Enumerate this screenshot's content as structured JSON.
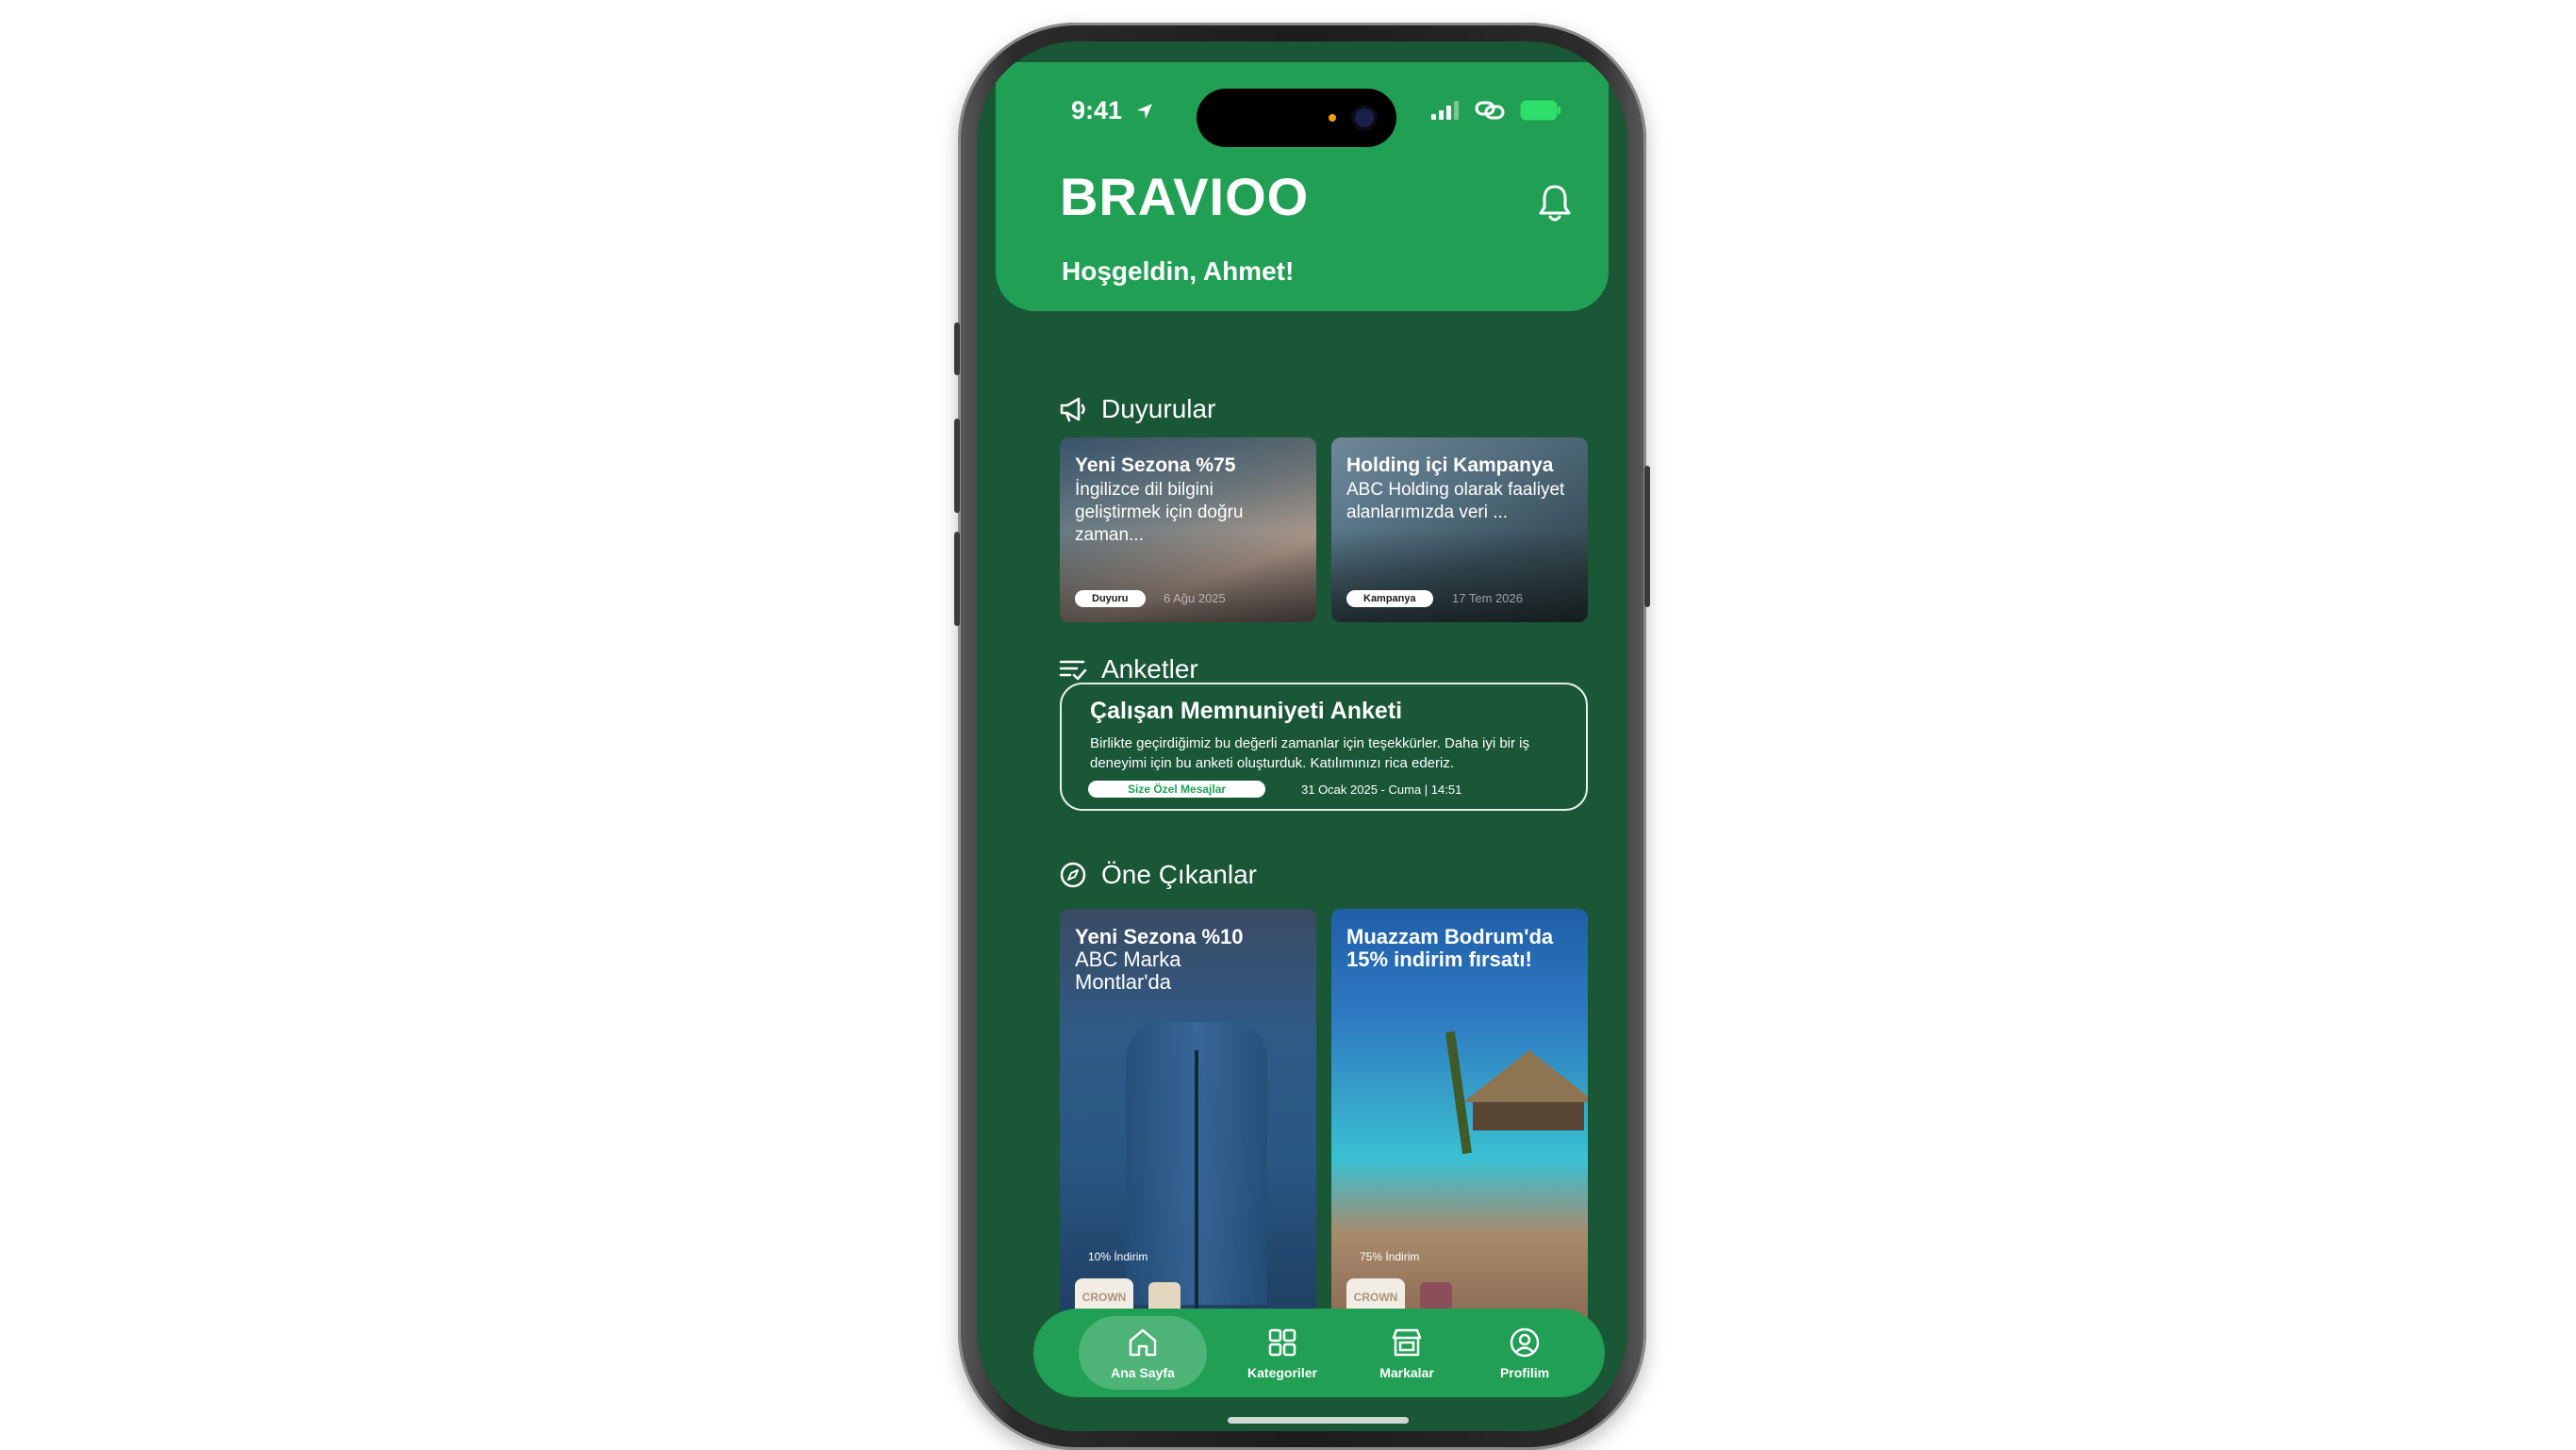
{
  "status_bar": {
    "time": "9:41"
  },
  "header": {
    "brand": "BRAVIOO",
    "greeting": "Hoşgeldin, Ahmet!"
  },
  "announcements": {
    "title": "Duyurular",
    "items": [
      {
        "title": "Yeni Sezona %75",
        "description": "İngilizce dil bilgini geliştirmek için doğru zaman...",
        "tag": "Duyuru",
        "date": "6 Ağu 2025"
      },
      {
        "title": "Holding içi Kampanya",
        "description": "ABC Holding olarak faaliyet alanlarımızda veri ...",
        "tag": "Kampanya",
        "date": "17 Tem 2026"
      }
    ]
  },
  "surveys": {
    "title": "Anketler",
    "item": {
      "title": "Çalışan Memnuniyeti Anketi",
      "description": "Birlikte geçirdiğimiz bu değerli zamanlar için teşekkürler. Daha iyi bir iş deneyimi için bu anketi oluşturduk. Katılımınızı rica ederiz.",
      "tag": "Size Özel Mesajlar",
      "date": "31 Ocak 2025 - Cuma | 14:51"
    }
  },
  "highlights": {
    "title": "Öne Çıkanlar",
    "items": [
      {
        "title": "Yeni Sezona %10",
        "subtitle": "ABC Marka Montlar'da",
        "discount": "10% İndirim",
        "brand_logo": "CROWN"
      },
      {
        "title": "Muazzam Bodrum'da 15% indirim fırsatı!",
        "subtitle": "",
        "discount": "75% İndirim",
        "brand_logo": "CROWN"
      }
    ]
  },
  "tab_bar": {
    "items": [
      {
        "label": "Ana Sayfa",
        "icon": "home-icon",
        "active": true
      },
      {
        "label": "Kategoriler",
        "icon": "grid-icon",
        "active": false
      },
      {
        "label": "Markalar",
        "icon": "store-icon",
        "active": false
      },
      {
        "label": "Profilim",
        "icon": "user-circle-icon",
        "active": false
      }
    ]
  },
  "colors": {
    "primary": "#21a055",
    "background": "#1a5737",
    "text": "#ffffff"
  }
}
